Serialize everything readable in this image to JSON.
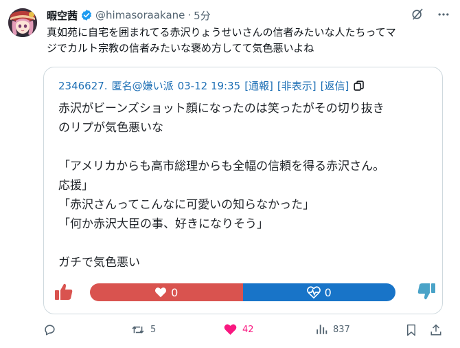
{
  "author": {
    "display_name": "暇空茜",
    "handle": "@himasoraakane",
    "separator": "·",
    "time": "5分"
  },
  "tweet": {
    "lines": [
      "真如苑に自宅を囲まれてる赤沢りょうせいさんの信者みたいな人たちってマ",
      "ジでカルト宗教の信者みたいな褒め方してて気色悪いよね"
    ]
  },
  "quote": {
    "header": {
      "post_number": "2346627.",
      "name": "匿名@嫌い派",
      "datetime": "03-12 19:35",
      "report": "[通報]",
      "hide": "[非表示]",
      "reply": "[返信]"
    },
    "body_lines": [
      "赤沢がビーンズショット顔になったのは笑ったがその切り抜き",
      "のリプが気色悪いな",
      "",
      "「アメリカからも高市総理からも全幅の信頼を得る赤沢さん。",
      "応援」",
      "「赤沢さんってこんなに可愛いの知らなかった」",
      "「何か赤沢大臣の事、好きになりそう」",
      "",
      "ガチで気色悪い"
    ],
    "votes": {
      "like_count": "0",
      "dislike_count": "0",
      "like_share": 0.5,
      "like_color": "#d9534f",
      "dislike_color": "#1874c8"
    }
  },
  "actions": {
    "reply_count": "",
    "retweet_count": "5",
    "like_count": "42",
    "views_count": "837",
    "like_color": "#f91880",
    "verified_color": "#1d9bf0"
  }
}
